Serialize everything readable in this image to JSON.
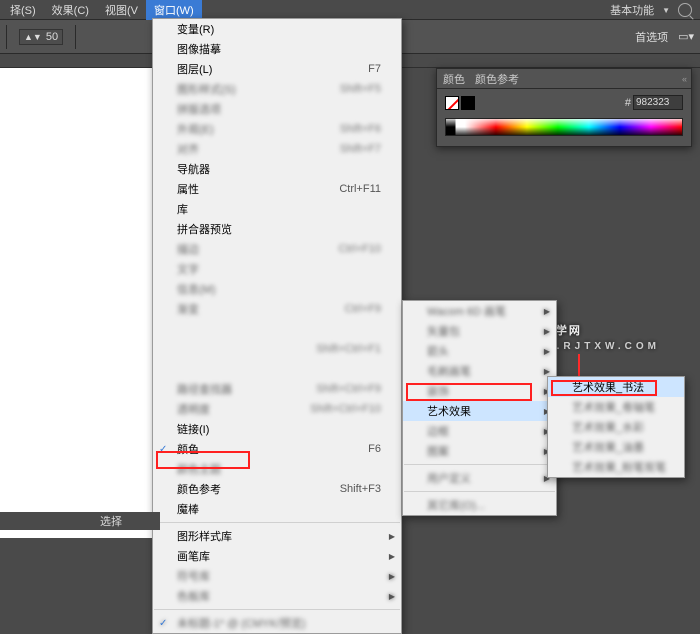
{
  "topbar": {
    "items": [
      "择(S)",
      "效果(C)",
      "视图(V",
      "窗口(W)"
    ],
    "active_index": 3,
    "right_label": "基本功能",
    "search_name": "search-icon"
  },
  "toolbar": {
    "combo_value": "50",
    "pref_label": "首选项",
    "dropdown_icon": "▼"
  },
  "color_panel": {
    "tab1": "颜色",
    "tab2": "颜色参考",
    "hex_label": "#",
    "hex_value": "982323",
    "close": "«"
  },
  "watermark": {
    "main": "软件自学网",
    "sub": "WWW.RJTXW.COM"
  },
  "statusbar": {
    "label": "选择"
  },
  "main_menu": [
    {
      "label": "变量(R)",
      "shortcut": ""
    },
    {
      "label": "图像描摹",
      "shortcut": ""
    },
    {
      "label": "图层(L)",
      "shortcut": "F7"
    },
    {
      "label": "图形样式(S)",
      "shortcut": "Shift+F5",
      "blur": true
    },
    {
      "label": "拼版选项",
      "shortcut": "",
      "blur": true
    },
    {
      "label": "外观(E)",
      "shortcut": "Shift+F6",
      "blur": true
    },
    {
      "label": "对齐",
      "shortcut": "Shift+F7",
      "blur": true
    },
    {
      "label": "导航器",
      "shortcut": ""
    },
    {
      "label": "属性",
      "shortcut": "Ctrl+F11"
    },
    {
      "label": "库",
      "shortcut": ""
    },
    {
      "label": "拼合器预览",
      "shortcut": ""
    },
    {
      "label": "描边",
      "shortcut": "Ctrl+F10",
      "blur": true
    },
    {
      "label": "文字",
      "shortcut": "",
      "blur": true
    },
    {
      "label": "信息(M)",
      "shortcut": "",
      "blur": true
    },
    {
      "label": "渐变",
      "shortcut": "Ctrl+F9",
      "blur": true
    },
    {
      "label": "",
      "shortcut": "",
      "blur": true
    },
    {
      "label": "",
      "shortcut": "Shift+Ctrl+F1",
      "blur": true
    },
    {
      "label": "",
      "shortcut": "",
      "blur": true
    },
    {
      "label": "路径查找器",
      "shortcut": "Shift+Ctrl+F9",
      "blur": true
    },
    {
      "label": "透明度",
      "shortcut": "Shift+Ctrl+F10",
      "blur": true
    },
    {
      "label": "链接(I)",
      "shortcut": ""
    },
    {
      "label": "颜色",
      "shortcut": "F6",
      "checked": true
    },
    {
      "label": "颜色主题",
      "shortcut": "",
      "blur": true
    },
    {
      "label": "颜色参考",
      "shortcut": "Shift+F3"
    },
    {
      "label": "魔棒",
      "shortcut": ""
    },
    {
      "sep": true
    },
    {
      "label": "图形样式库",
      "shortcut": "",
      "submenu": true
    },
    {
      "label": "画笔库",
      "shortcut": "",
      "submenu": true,
      "highlighted": true
    },
    {
      "label": "符号库",
      "shortcut": "",
      "submenu": true,
      "blur": true
    },
    {
      "label": "色板库",
      "shortcut": "",
      "submenu": true,
      "blur": true
    },
    {
      "sep": true
    },
    {
      "label": "未标题-1* @ (CMYK/预览)",
      "shortcut": "",
      "checked": true,
      "blur": true
    }
  ],
  "sub_menu1": [
    {
      "label": "Wacom 6D 画笔",
      "submenu": true,
      "blur": true
    },
    {
      "label": "矢量包",
      "submenu": true,
      "blur": true
    },
    {
      "label": "箭头",
      "submenu": true,
      "blur": true
    },
    {
      "label": "毛刷画笔",
      "submenu": true,
      "blur": true
    },
    {
      "label": "装饰",
      "submenu": true,
      "blur": true
    },
    {
      "label": "艺术效果",
      "submenu": true,
      "selected": true,
      "highlighted": true
    },
    {
      "label": "边框",
      "submenu": true,
      "blur": true
    },
    {
      "label": "图案",
      "submenu": true,
      "blur": true
    },
    {
      "sep": true
    },
    {
      "label": "用户定义",
      "submenu": true,
      "blur": true
    },
    {
      "sep": true
    },
    {
      "label": "其它库(O)...",
      "blur": true
    }
  ],
  "sub_menu2": [
    {
      "label": "艺术效果_书法",
      "selected": true,
      "highlighted": true
    },
    {
      "label": "艺术效果_卷轴笔",
      "blur": true
    },
    {
      "label": "艺术效果_水彩",
      "blur": true
    },
    {
      "label": "艺术效果_油墨",
      "blur": true
    },
    {
      "label": "艺术效果_粉笔炭笔",
      "blur": true
    }
  ],
  "chart_data": null
}
